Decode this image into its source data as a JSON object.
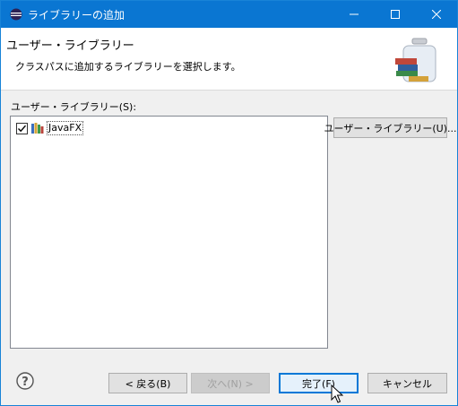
{
  "window": {
    "title": "ライブラリーの追加",
    "icons": {
      "app": "eclipse-icon",
      "minimize": "minimize-icon",
      "maximize": "maximize-icon",
      "close": "close-icon"
    }
  },
  "header": {
    "title": "ユーザー・ライブラリー",
    "description": "クラスパスに追加するライブラリーを選択します。",
    "image": "library-jar-icon"
  },
  "libraries": {
    "label": "ユーザー・ライブラリー(S):",
    "items": [
      {
        "label": "JavaFX",
        "checked": true,
        "icon": "library-icon"
      }
    ],
    "button_label": "ユーザー・ライブラリー(U)..."
  },
  "footer": {
    "help_icon": "help-icon",
    "back_label": "< 戻る(B)",
    "next_label": "次へ(N) >",
    "finish_label": "完了(F)",
    "cancel_label": "キャンセル"
  },
  "colors": {
    "titlebar": "#0a76d2",
    "default_button_border": "#0078d7",
    "window_bg": "#f0f0f0"
  }
}
